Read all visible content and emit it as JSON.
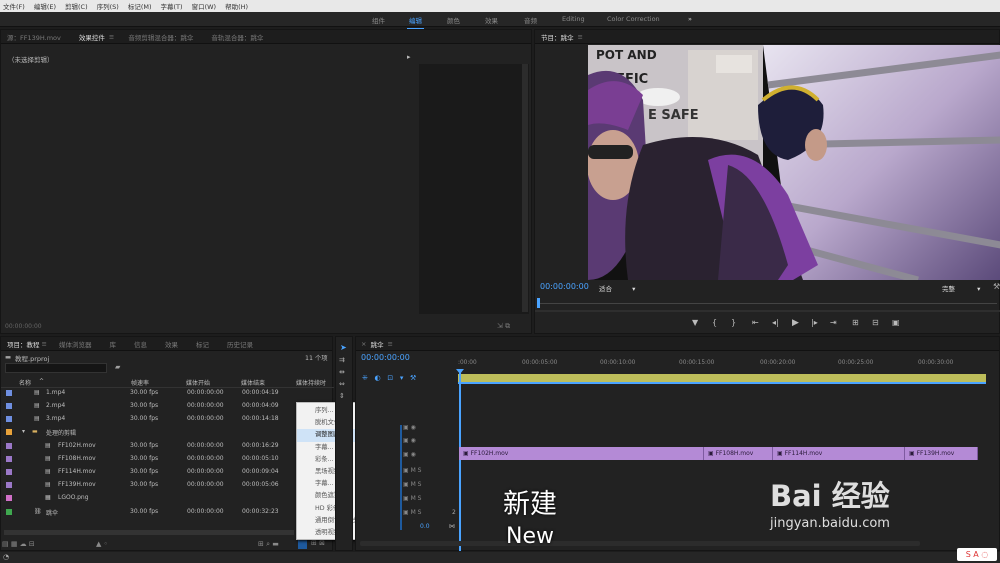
{
  "menubar": [
    "文件(F)",
    "编辑(E)",
    "剪辑(C)",
    "序列(S)",
    "标记(M)",
    "字幕(T)",
    "窗口(W)",
    "帮助(H)"
  ],
  "workspaces": [
    "组件",
    "编辑",
    "颜色",
    "效果",
    "音频",
    "Editing",
    "Color Correction"
  ],
  "workspace_more": "»",
  "source_tabs": [
    "源：FF139H.mov",
    "效果控件",
    "音频剪辑混合器：跳伞",
    "音轨混合器：跳伞"
  ],
  "source": {
    "no_clip": "（未选择剪辑）",
    "arrow": "▸",
    "timecode": "00:00:00:00"
  },
  "program": {
    "title": "节目：跳伞",
    "timecode": "00:00:00:00",
    "fit": "适合",
    "quality": "完整",
    "fit_caret": "▾",
    "quality_caret": "▾"
  },
  "program_controls": [
    "▼",
    "{",
    "}",
    "⇤",
    "◂|",
    "▶",
    "|▸",
    "⇥",
    "⊞",
    "⊟",
    "▣"
  ],
  "project_tabs": [
    "项目：教程",
    "媒体浏览器",
    "库",
    "信息",
    "效果",
    "标记",
    "历史记录"
  ],
  "project": {
    "file": "教程.prproj",
    "count": "11 个项",
    "headers": [
      "名称",
      "帧速率",
      "媒体开始",
      "媒体结束",
      "媒体持续时"
    ],
    "rows": [
      {
        "name": "1.mp4",
        "fps": "30.00 fps",
        "start": "00:00:00:00",
        "end": "00:00:04:19",
        "color": "#6f8fe0"
      },
      {
        "name": "2.mp4",
        "fps": "30.00 fps",
        "start": "00:00:00:00",
        "end": "00:00:04:09",
        "color": "#6f8fe0"
      },
      {
        "name": "3.mp4",
        "fps": "30.00 fps",
        "start": "00:00:00:00",
        "end": "00:00:14:18",
        "color": "#6f8fe0"
      },
      {
        "name": "处理的剪辑",
        "fps": "",
        "start": "",
        "end": "",
        "color": "#e8a23a"
      },
      {
        "name": "FF102H.mov",
        "fps": "30.00 fps",
        "start": "00:00:00:00",
        "end": "00:00:16:29",
        "color": "#9b78c8"
      },
      {
        "name": "FF108H.mov",
        "fps": "30.00 fps",
        "start": "00:00:00:00",
        "end": "00:00:05:10",
        "color": "#9b78c8"
      },
      {
        "name": "FF114H.mov",
        "fps": "30.00 fps",
        "start": "00:00:00:00",
        "end": "00:00:09:04",
        "color": "#9b78c8"
      },
      {
        "name": "FF139H.mov",
        "fps": "30.00 fps",
        "start": "00:00:00:00",
        "end": "00:00:05:06",
        "color": "#9b78c8"
      },
      {
        "name": "LGOO.png",
        "fps": "",
        "start": "",
        "end": "",
        "color": "#d070c8"
      },
      {
        "name": "跳伞",
        "fps": "30.00 fps",
        "start": "00:00:00:00",
        "end": "00:00:32:23",
        "color": "#3fa84f"
      }
    ]
  },
  "context_menu": [
    "序列...",
    "脱机文件...",
    "调整图层...",
    "字幕...",
    "彩条...",
    "黑场视频...",
    "字幕...",
    "颜色遮罩...",
    "HD 彩条...",
    "通用倒计时片头...",
    "透明视频..."
  ],
  "timeline": {
    "tab": "跳伞",
    "timecode": "00:00:00:00",
    "ruler": [
      ":00:00",
      "00:00:05:00",
      "00:00:10:00",
      "00:00:15:00",
      "00:00:20:00",
      "00:00:25:00",
      "00:00:30:00"
    ],
    "clips": [
      "FF102H.mov",
      "FF108H.mov",
      "FF114H.mov",
      "FF139H.mov"
    ],
    "track_value": "0.0",
    "track_num": "2"
  },
  "subtitle": {
    "cn": "新建",
    "en": "New"
  },
  "watermark": {
    "brand": "Bai 经验",
    "url": "jingyan.baidu.com"
  },
  "video_text": {
    "sign1": "POT AND",
    "sign2": "RAFFIC",
    "sign3": "E SAFE"
  }
}
